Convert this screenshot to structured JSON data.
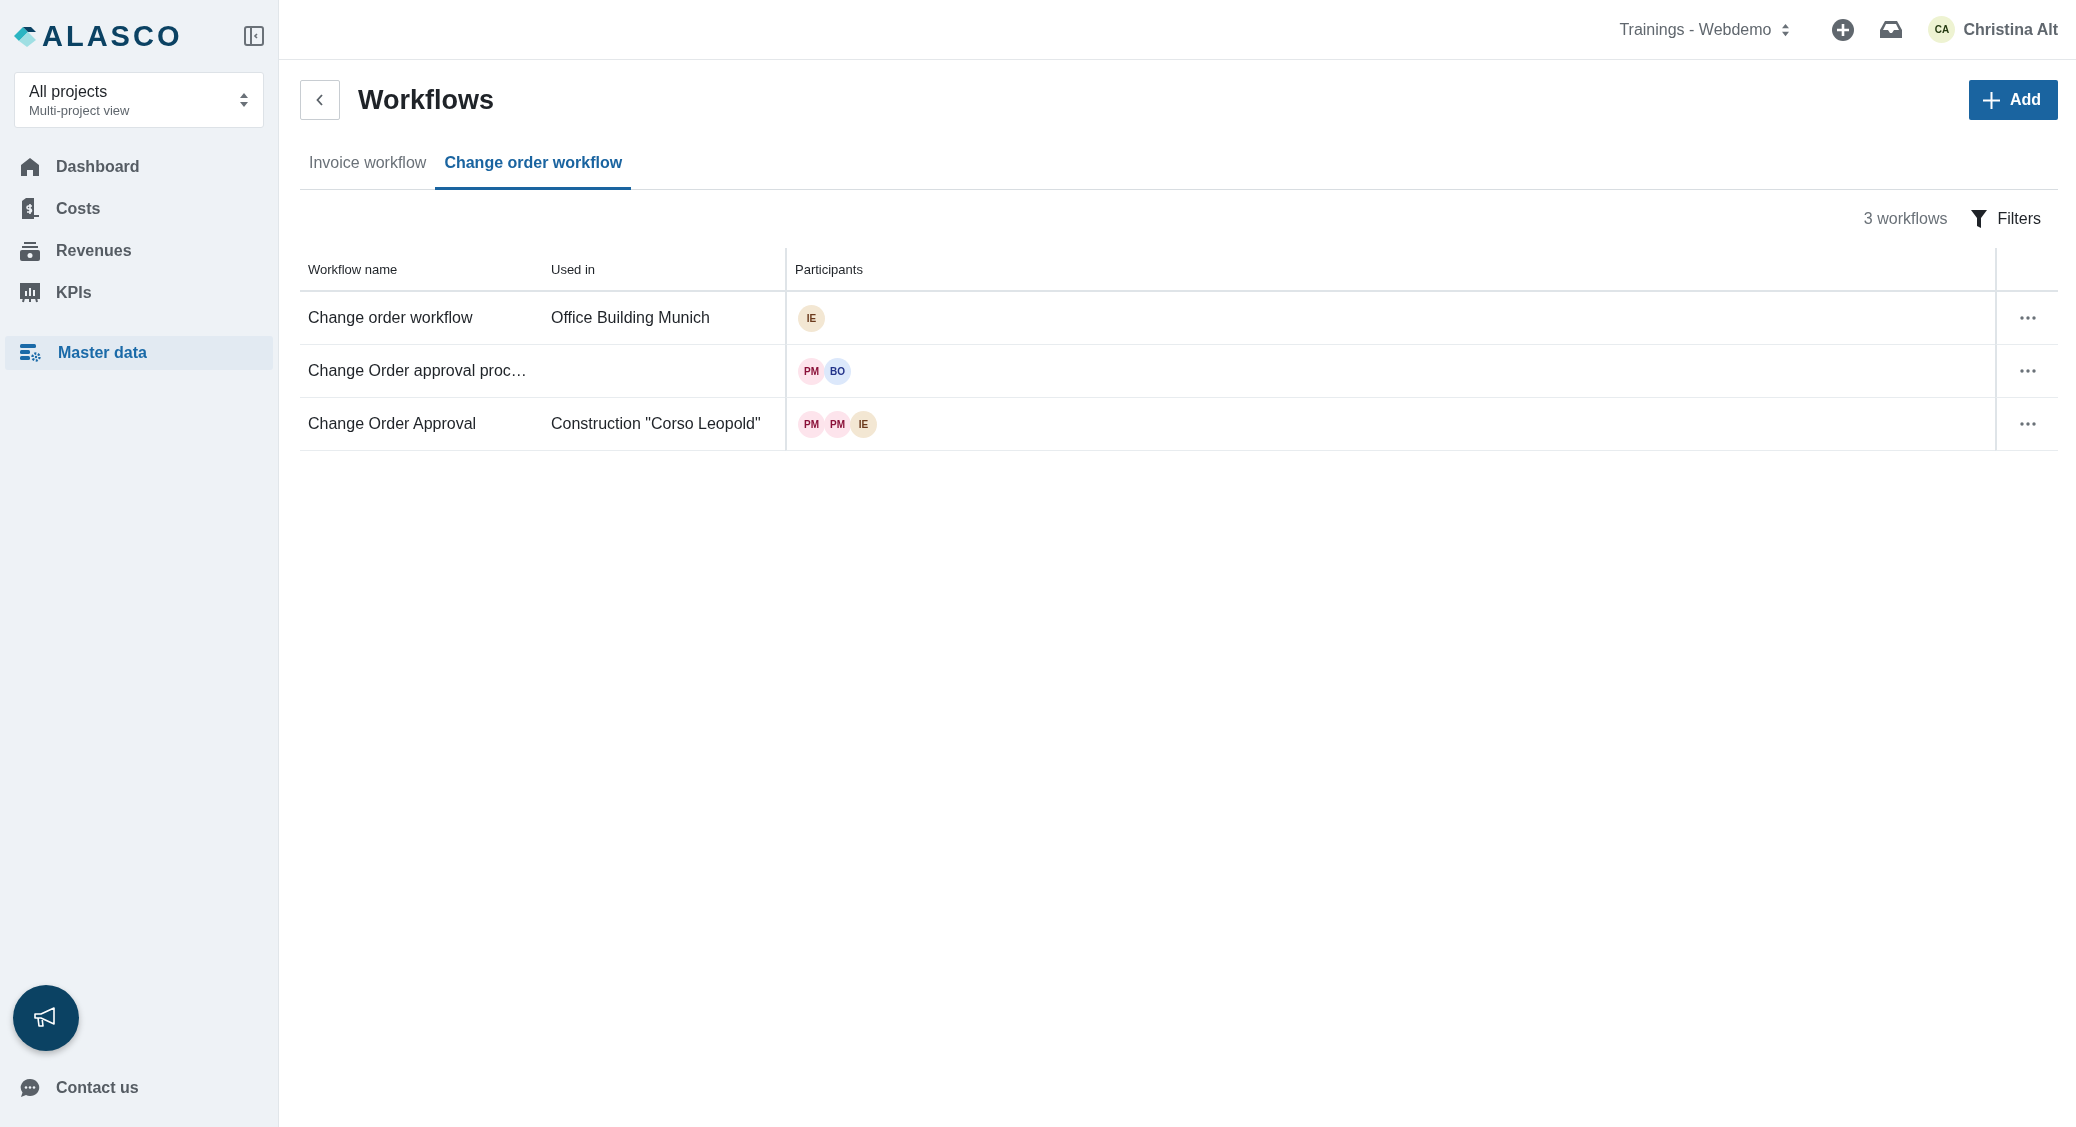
{
  "sidebar": {
    "logo": "ALASCO",
    "project_selector": {
      "title": "All projects",
      "subtitle": "Multi-project view"
    },
    "items": [
      {
        "kind": "home",
        "label": "Dashboard",
        "selected": false
      },
      {
        "kind": "costs",
        "label": "Costs",
        "selected": false
      },
      {
        "kind": "revenues",
        "label": "Revenues",
        "selected": false
      },
      {
        "kind": "kpis",
        "label": "KPIs",
        "selected": false
      },
      {
        "kind": "master",
        "label": "Master data",
        "selected": true
      }
    ],
    "contact": "Contact us"
  },
  "topbar": {
    "workspace": "Trainings - Webdemo",
    "user": {
      "initials": "CA",
      "name": "Christina Alt"
    }
  },
  "page": {
    "title": "Workflows",
    "add_button": "Add",
    "tabs": [
      {
        "label": "Invoice workflow",
        "selected": false
      },
      {
        "label": "Change order workflow",
        "selected": true
      }
    ],
    "count": "3 workflows",
    "filters": "Filters"
  },
  "table": {
    "columns": [
      "Workflow name",
      "Used in",
      "Participants"
    ],
    "rows": [
      {
        "name": "Change order workflow",
        "used_in": "Office Building Munich",
        "participants": [
          {
            "initials": "IE",
            "color": "#f3e7d3"
          }
        ]
      },
      {
        "name": "Change Order approval proc…",
        "participants": [
          {
            "initials": "PM",
            "color": "#fde4ec"
          },
          {
            "initials": "BO",
            "color": "#dce8fb"
          }
        ]
      },
      {
        "name": "Change Order Approval",
        "used_in": "Construction \"Corso Leopold\"",
        "participants": [
          {
            "initials": "PM",
            "color": "#fde4ec"
          },
          {
            "initials": "PM",
            "color": "#fde4ec"
          },
          {
            "initials": "IE",
            "color": "#f3e7d3"
          }
        ]
      }
    ]
  }
}
